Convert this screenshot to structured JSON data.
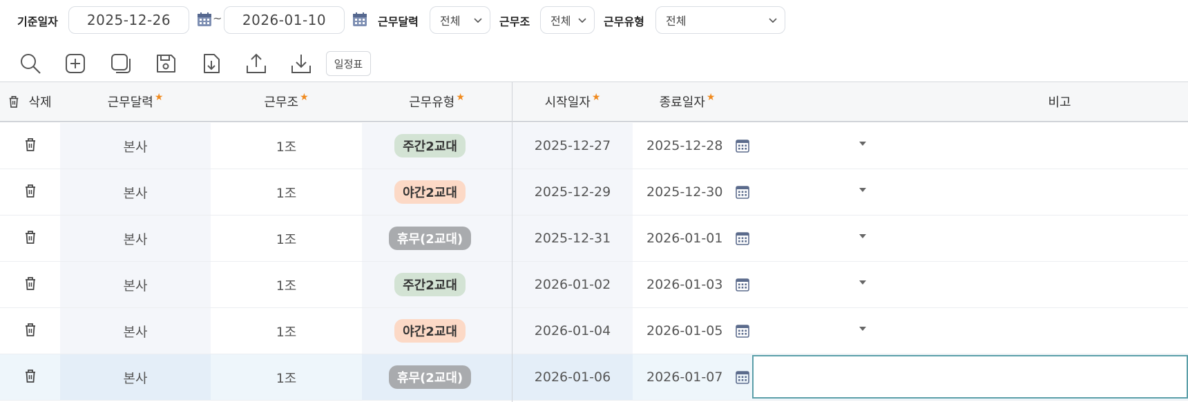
{
  "filters": {
    "base_date_label": "기준일자",
    "date_from": "2025-12-26",
    "range_sep": "~",
    "date_to": "2026-01-10",
    "calendar_label": "근무달력",
    "calendar_value": "전체",
    "shift_group_label": "근무조",
    "shift_group_value": "전체",
    "work_type_label": "근무유형",
    "work_type_value": "전체"
  },
  "toolbar": {
    "icons": [
      "search-icon",
      "add-icon",
      "copy-icon",
      "save-icon",
      "import-icon",
      "upload-icon",
      "download-icon"
    ],
    "schedule_button": "일정표"
  },
  "grid": {
    "columns": {
      "delete": "삭제",
      "calendar": "근무달력",
      "shift_group": "근무조",
      "work_type": "근무유형",
      "start_date": "시작일자",
      "end_date": "종료일자",
      "remarks": "비고"
    },
    "required_mark": "★",
    "rows": [
      {
        "calendar": "본사",
        "shift_group": "1조",
        "work_type": "주간2교대",
        "start": "2025-12-27",
        "end": "2025-12-28",
        "remarks": ""
      },
      {
        "calendar": "본사",
        "shift_group": "1조",
        "work_type": "야간2교대",
        "start": "2025-12-29",
        "end": "2025-12-30",
        "remarks": ""
      },
      {
        "calendar": "본사",
        "shift_group": "1조",
        "work_type": "휴무(2교대)",
        "start": "2025-12-31",
        "end": "2026-01-01",
        "remarks": ""
      },
      {
        "calendar": "본사",
        "shift_group": "1조",
        "work_type": "주간2교대",
        "start": "2026-01-02",
        "end": "2026-01-03",
        "remarks": ""
      },
      {
        "calendar": "본사",
        "shift_group": "1조",
        "work_type": "야간2교대",
        "start": "2026-01-04",
        "end": "2026-01-05",
        "remarks": ""
      },
      {
        "calendar": "본사",
        "shift_group": "1조",
        "work_type": "휴무(2교대)",
        "start": "2026-01-06",
        "end": "2026-01-07",
        "remarks": ""
      }
    ],
    "selected_row": 5
  },
  "colors": {
    "day_shift": "#d3e3d4",
    "night_shift": "#fcd9c6",
    "off_shift": "#a9abae",
    "required_star": "#f08a1e",
    "edit_border": "#5a9ea8"
  }
}
